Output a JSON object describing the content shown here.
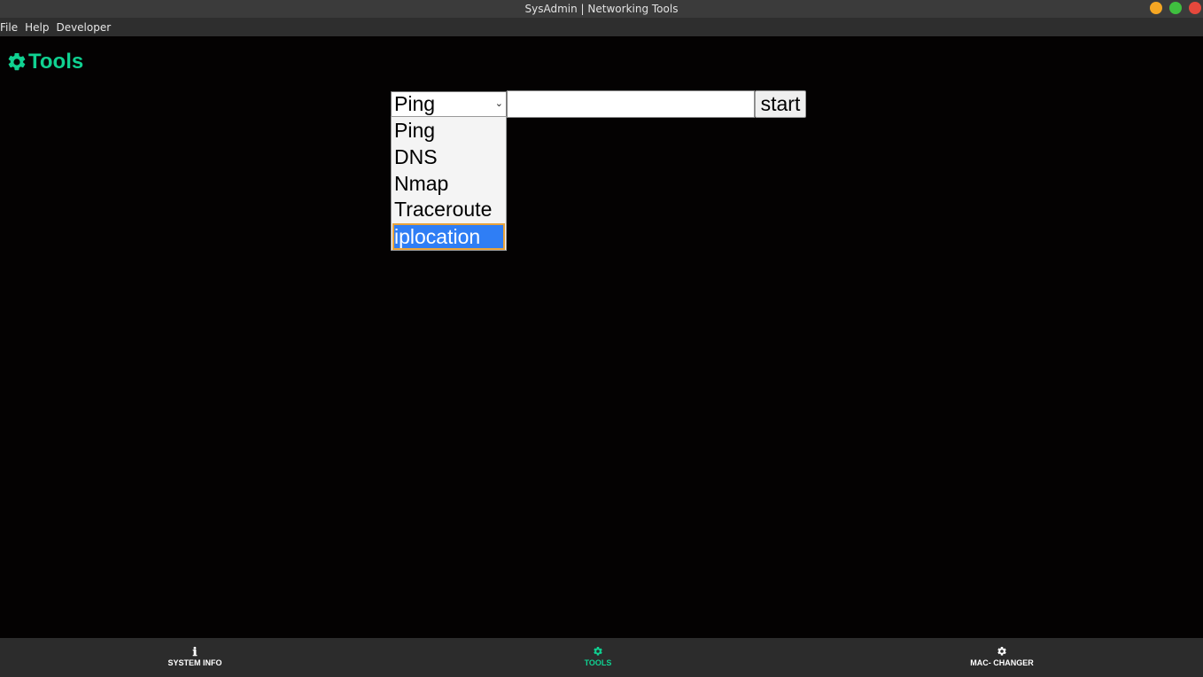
{
  "window": {
    "title": "SysAdmin | Networking Tools"
  },
  "menubar": {
    "items": [
      "File",
      "Help",
      "Developer"
    ]
  },
  "page": {
    "heading": "Tools",
    "heading_icon": "gear-icon",
    "accent_color": "#10d191"
  },
  "tool_form": {
    "selected_tool": "Ping",
    "target_value": "",
    "start_label": "start",
    "options": [
      "Ping",
      "DNS",
      "Nmap",
      "Traceroute",
      "iplocation"
    ],
    "highlighted_option": "iplocation"
  },
  "bottom_nav": {
    "items": [
      {
        "label": "SYSTEM INFO",
        "icon": "info-icon",
        "active": false
      },
      {
        "label": "TOOLS",
        "icon": "gear-icon",
        "active": true
      },
      {
        "label": "MAC- CHANGER",
        "icon": "gear-icon",
        "active": false
      }
    ]
  }
}
